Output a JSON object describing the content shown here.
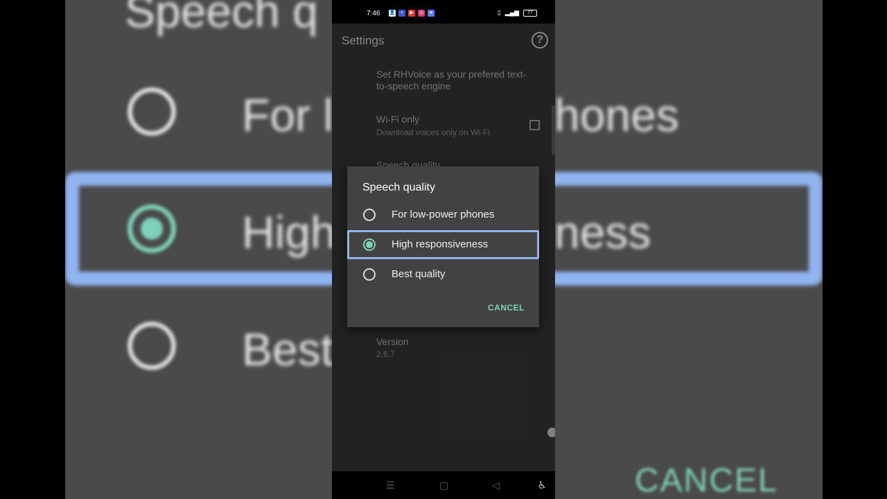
{
  "backdrop": {
    "title_fragment": "Speech q",
    "option_low_fragment_left": "For l",
    "option_low_fragment_right": "hones",
    "option_high_fragment_left": "High",
    "option_high_fragment_right": "ness",
    "option_best_fragment": "Best",
    "cancel": "CANCEL"
  },
  "status_bar": {
    "time": "7:46",
    "battery": "77",
    "signal_label": "LTE"
  },
  "app_bar": {
    "title": "Settings",
    "help_icon": "question-mark-icon"
  },
  "settings": {
    "engine_pref": "Set RHVoice as your prefered text-to-speech engine",
    "wifi_title": "Wi-Fi only",
    "wifi_sub": "Download voices only on Wi-Fi",
    "wifi_checked": false,
    "speech_quality_title": "Speech quality",
    "version_title": "Version",
    "version_value": "2.6.7"
  },
  "dialog": {
    "title": "Speech quality",
    "options": [
      {
        "label": "For low-power phones",
        "selected": false
      },
      {
        "label": "High responsiveness",
        "selected": true
      },
      {
        "label": "Best quality",
        "selected": false
      }
    ],
    "cancel_label": "CANCEL"
  },
  "nav_bar": {
    "menu_icon": "menu-icon",
    "home_icon": "square-home-icon",
    "back_icon": "triangle-back-icon",
    "accessibility_icon": "accessibility-icon"
  },
  "colors": {
    "accent": "#7fd1b9",
    "focus": "#8fb4f0",
    "dialog_bg": "#424242"
  }
}
